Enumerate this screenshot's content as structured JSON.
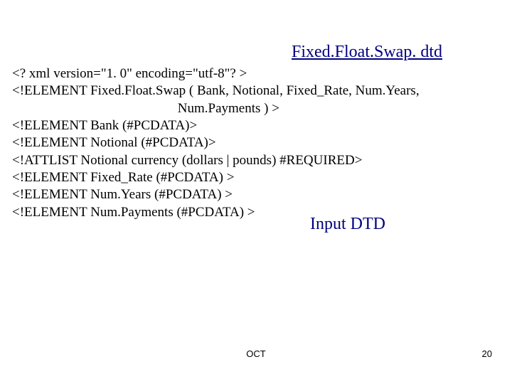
{
  "title": "Fixed.Float.Swap. dtd",
  "code": "<? xml version=\"1. 0\" encoding=\"utf-8\"? >\n<!ELEMENT Fixed.Float.Swap ( Bank, Notional, Fixed_Rate, Num.Years,\n                                                 Num.Payments ) >\n<!ELEMENT Bank (#PCDATA)>\n<!ELEMENT Notional (#PCDATA)>\n<!ATTLIST Notional currency (dollars | pounds) #REQUIRED>\n<!ELEMENT Fixed_Rate (#PCDATA) >\n<!ELEMENT Num.Years (#PCDATA) >\n<!ELEMENT Num.Payments (#PCDATA) >",
  "subtitle": "Input DTD",
  "footer": {
    "center": "OCT",
    "page": "20"
  }
}
